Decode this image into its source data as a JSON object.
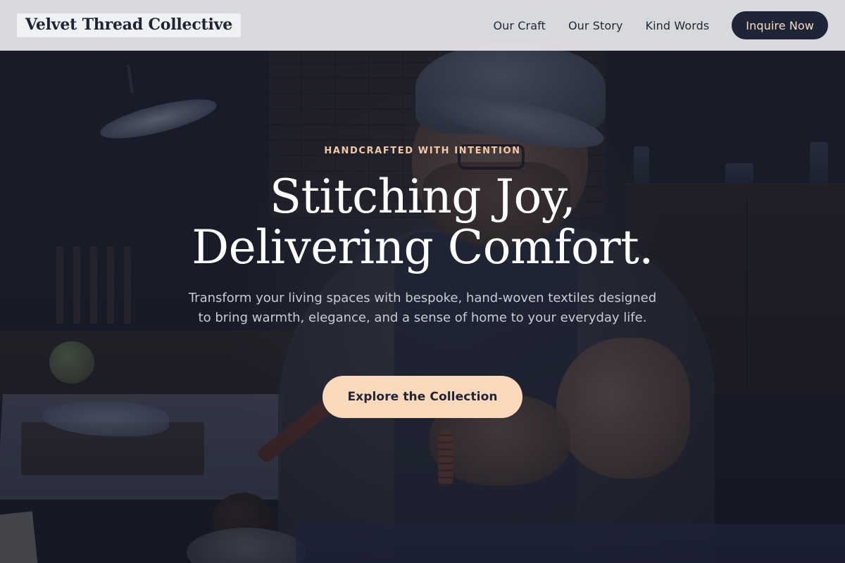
{
  "header": {
    "brand": "Velvet Thread Collective",
    "nav": [
      {
        "label": "Our Craft"
      },
      {
        "label": "Our Story"
      },
      {
        "label": "Kind Words"
      }
    ],
    "cta_label": "Inquire Now"
  },
  "hero": {
    "eyebrow": "HANDCRAFTED WITH INTENTION",
    "title_line1": "Stitching Joy,",
    "title_line2": "Delivering Comfort.",
    "subtitle": "Transform your living spaces with bespoke, hand-woven textiles designed to bring warmth, elegance, and a sense of home to your everyday life.",
    "cta_label": "Explore the Collection",
    "background_image": "craftsman-at-workbench-photo"
  },
  "colors": {
    "navbar_bg": "#e8e9ec",
    "brand_text": "#1d2433",
    "dark_navy": "#1e2536",
    "peach_accent": "#fdd9bc",
    "eyebrow_text": "#f2c9a6",
    "hero_overlay": "#161a28"
  }
}
